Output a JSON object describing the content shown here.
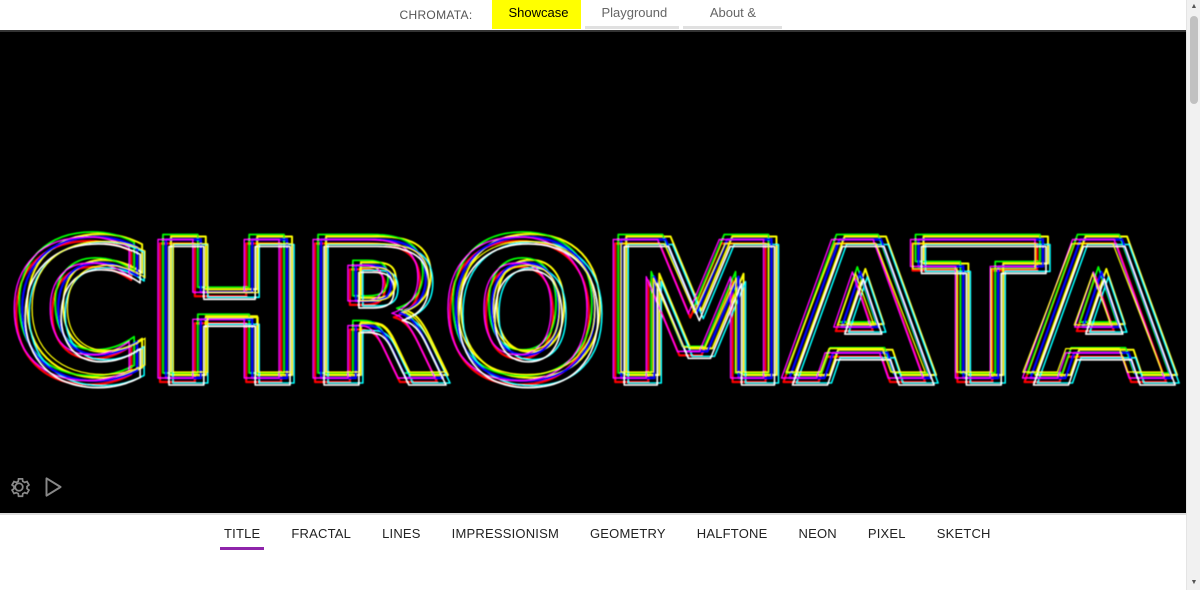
{
  "topnav": {
    "brand": "CHROMATA:",
    "tabs": [
      {
        "label": "Showcase",
        "active": true
      },
      {
        "label": "Playground",
        "active": false
      },
      {
        "label": "About & API",
        "active": false
      }
    ]
  },
  "canvas": {
    "title_text": "CHROMATA",
    "background": "#000000",
    "palette": [
      "#ff0000",
      "#ffff00",
      "#00ff00",
      "#00ffff",
      "#0000ff",
      "#ff00ff",
      "#ffffff"
    ],
    "controls": [
      {
        "icon": "gear-icon"
      },
      {
        "icon": "play-icon"
      }
    ]
  },
  "bottomnav": {
    "tabs": [
      {
        "label": "TITLE",
        "active": true
      },
      {
        "label": "FRACTAL",
        "active": false
      },
      {
        "label": "LINES",
        "active": false
      },
      {
        "label": "IMPRESSIONISM",
        "active": false
      },
      {
        "label": "GEOMETRY",
        "active": false
      },
      {
        "label": "HALFTONE",
        "active": false
      },
      {
        "label": "NEON",
        "active": false
      },
      {
        "label": "PIXEL",
        "active": false
      },
      {
        "label": "SKETCH",
        "active": false
      }
    ],
    "active_color": "#8e24aa"
  },
  "accent": "#ffff00"
}
